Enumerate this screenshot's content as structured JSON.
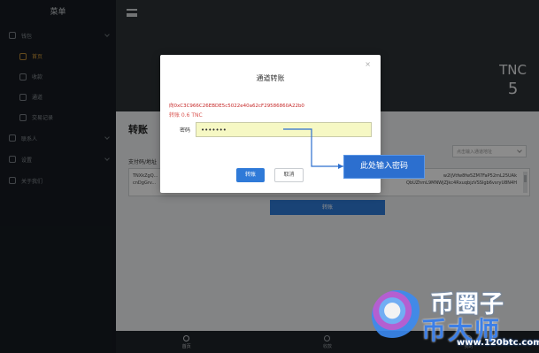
{
  "sidebar": {
    "title": "菜单",
    "items": [
      {
        "label": "钱包",
        "sub": false,
        "active": false,
        "caret": true
      },
      {
        "label": "首页",
        "sub": true,
        "active": true
      },
      {
        "label": "收款",
        "sub": true,
        "active": false
      },
      {
        "label": "通道",
        "sub": true,
        "active": false
      },
      {
        "label": "交易记录",
        "sub": true,
        "active": false
      },
      {
        "label": "联系人",
        "sub": false,
        "active": false,
        "caret": true
      },
      {
        "label": "设置",
        "sub": false,
        "active": false,
        "caret": true
      },
      {
        "label": "关于我们",
        "sub": false,
        "active": false
      }
    ]
  },
  "header": {
    "token": "TNC",
    "balance": "5"
  },
  "content": {
    "title": "转账",
    "address_label": "支付码/地址",
    "address_value_left": "TNXkZgQ...\ncnDgGrv...",
    "address_value_right": "w2ljVtfw8fw5ZM7FaP52mL25UAk\nQbUZhmL9MNWjZJkc4RxuqbjzVSSlgb6vsryU8N4H",
    "select_placeholder": "点击输入通道地址",
    "transfer_button": "转账"
  },
  "modal": {
    "title": "通道转账",
    "close": "×",
    "to_address": "向0xC3C966C26EBDE5c5022e40a62cF29586860A22b0",
    "amount": "转账 0.6 TNC",
    "password_label": "密码",
    "password_value": "•••••••",
    "ok_button": "转账",
    "cancel_button": "取消"
  },
  "callout": {
    "text": "此处输入密码"
  },
  "bottom_nav": [
    {
      "label": "首页",
      "active": true
    },
    {
      "label": "收款",
      "active": false
    },
    {
      "label": "我的",
      "active": false
    }
  ],
  "watermark": {
    "line1": "币圈子",
    "line2": "币大师",
    "url": "www.120btc.com"
  },
  "colors": {
    "accent": "#2f7ad8",
    "active_nav": "#d39a3a",
    "error": "#d9534f",
    "input_bg": "#f6f8c4"
  }
}
